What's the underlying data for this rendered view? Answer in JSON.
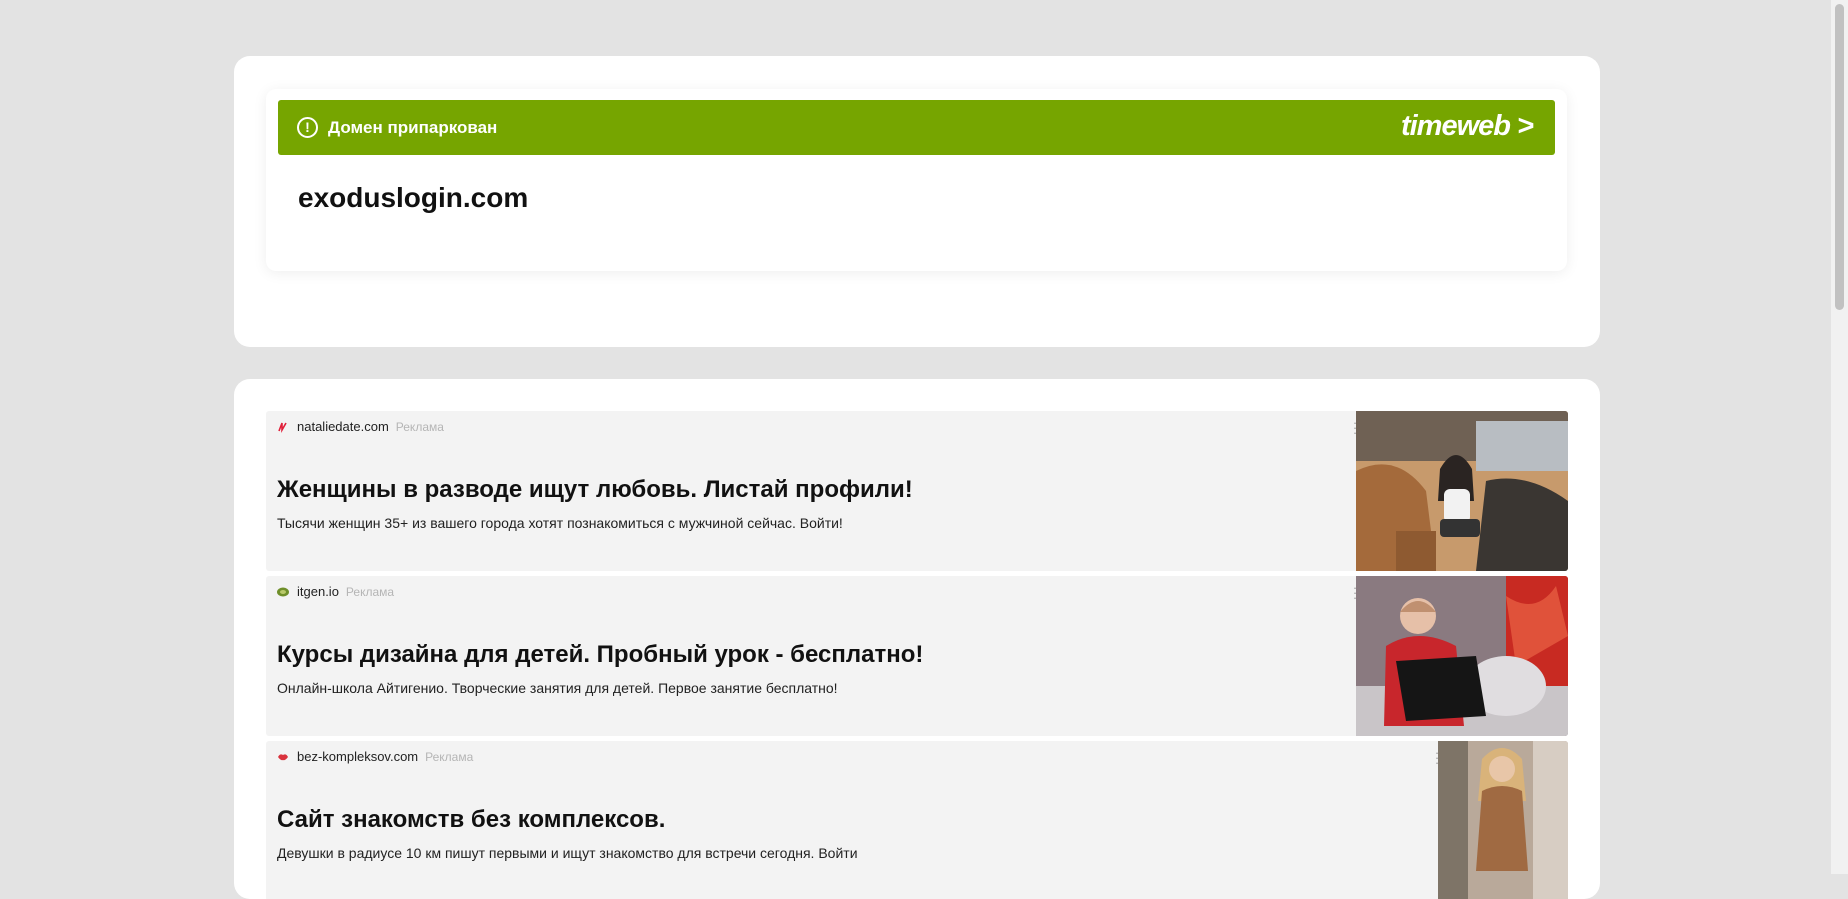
{
  "parking": {
    "status_text": "Домен припаркован",
    "brand_logo": "timeweb >",
    "domain": "exoduslogin.com",
    "colors": {
      "banner": "#76a500",
      "background": "#e3e3e3"
    }
  },
  "ads": [
    {
      "source": "nataliedate.com",
      "label": "Реклама",
      "title": "Женщины в разводе ищут любовь. Листай профили!",
      "description": "Тысячи женщин 35+ из вашего города хотят познакомиться с мужчиной сейчас. Войти!",
      "image": "woman-in-car-photo"
    },
    {
      "source": "itgen.io",
      "label": "Реклама",
      "title": "Курсы дизайна для детей. Пробный урок - бесплатно!",
      "description": "Онлайн-школа Айтигенио. Творческие занятия для детей. Первое занятие бесплатно!",
      "image": "child-with-laptop-photo"
    },
    {
      "source": "bez-kompleksov.com",
      "label": "Реклама",
      "title": "Сайт знакомств без комплексов.",
      "description": "Девушки в радиусе 10 км пишут первыми и ищут знакомство для встречи сегодня. Войти",
      "image": "woman-in-dress-photo"
    }
  ]
}
